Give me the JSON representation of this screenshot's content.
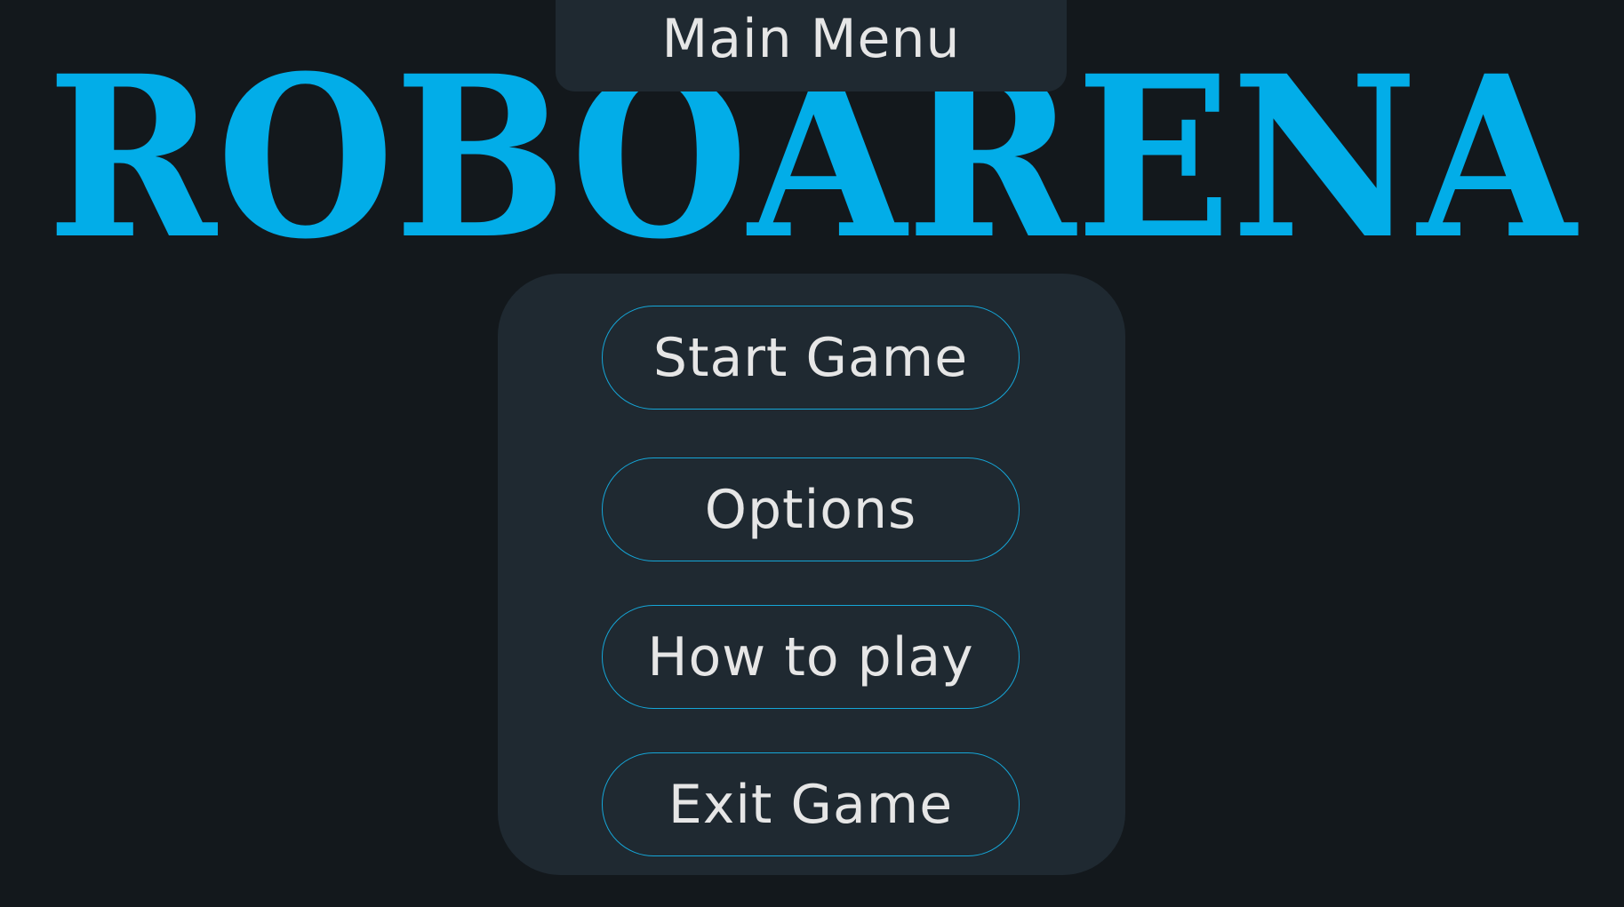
{
  "game": {
    "title": "ROBOARENA",
    "title_color": "#02ade8"
  },
  "header": {
    "label": "Main Menu"
  },
  "menu": {
    "start_label": "Start Game",
    "options_label": "Options",
    "howto_label": "How to play",
    "exit_label": "Exit Game"
  },
  "colors": {
    "background": "#13181c",
    "panel": "#1f2931",
    "button_border": "#15a6d8",
    "text": "#e6e6e6"
  }
}
